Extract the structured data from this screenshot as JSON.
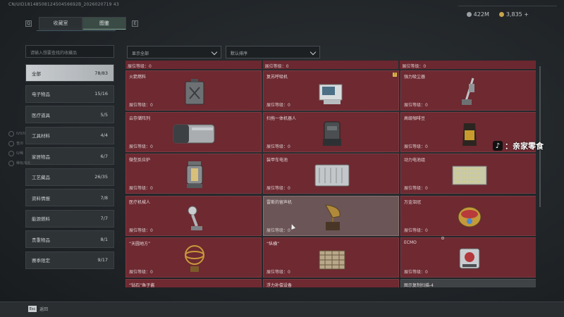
{
  "header": {
    "uid": "CN/UID1814850812450456692B_2026020719 43",
    "currencies": [
      {
        "icon": "silver-coin-icon",
        "value": "422M"
      },
      {
        "icon": "gold-coin-icon",
        "value": "3,835 +"
      }
    ]
  },
  "tabs": {
    "left_key": "Q",
    "right_key": "E",
    "items": [
      {
        "label": "收藏室",
        "active": false
      },
      {
        "label": "图鉴",
        "active": true
      }
    ]
  },
  "search": {
    "placeholder": "请输入想要查找的收藏品"
  },
  "filters": {
    "display": "显示全部",
    "sort": "默认排序"
  },
  "categories": [
    {
      "label": "全部",
      "count": "78/83",
      "active": true
    },
    {
      "label": "电子物品",
      "count": "15/16"
    },
    {
      "label": "医疗道具",
      "count": "5/5"
    },
    {
      "label": "工具材料",
      "count": "4/4"
    },
    {
      "label": "家居物品",
      "count": "6/7"
    },
    {
      "label": "工艺藏品",
      "count": "26/35"
    },
    {
      "label": "资料情报",
      "count": "7/8"
    },
    {
      "label": "能源燃料",
      "count": "7/7"
    },
    {
      "label": "贵重物品",
      "count": "8/1"
    },
    {
      "label": "赛季限定",
      "count": "9/17"
    }
  ],
  "level_label": "展位等级：0",
  "partial_top": [
    "展位等级：0",
    "展位等级：0",
    "展位等级：0"
  ],
  "cards": [
    {
      "name": "火箭燃料",
      "icon": "fuel-can-icon"
    },
    {
      "name": "复苏呼吸机",
      "icon": "ventilator-icon",
      "flag": "!"
    },
    {
      "name": "强力吸尘器",
      "icon": "vacuum-icon"
    },
    {
      "name": "云存储阵列",
      "icon": "storage-array-icon"
    },
    {
      "name": "扫拖一体机器人",
      "icon": "robot-mop-icon"
    },
    {
      "name": "高级咖啡豆",
      "icon": "coffee-bag-icon"
    },
    {
      "name": "微型反应炉",
      "icon": "reactor-icon"
    },
    {
      "name": "装甲车电池",
      "icon": "battery-icon"
    },
    {
      "name": "动力电池组",
      "icon": "battery-pack-icon"
    },
    {
      "name": "医疗机械人",
      "icon": "medical-robot-icon"
    },
    {
      "name": "雷斯的留声机",
      "icon": "gramophone-icon",
      "hover": true
    },
    {
      "name": "万金泪冠",
      "icon": "jeweled-crown-icon"
    },
    {
      "name": "“天圆地方”",
      "icon": "armillary-icon"
    },
    {
      "name": "“纵横”",
      "icon": "chessboard-icon"
    },
    {
      "name": "ECMO",
      "icon": "ecmo-icon"
    },
    {
      "name": "“钻石”鱼子酱",
      "icon": "caviar-icon"
    },
    {
      "name": "浮力补偿设备",
      "icon": "bcd-icon"
    },
    {
      "name": "图示复制扫描-4",
      "icon": "scan-icon",
      "dark": true
    }
  ],
  "side_ghost": [
    "0/0/0",
    "普/0",
    "0/稀",
    "稀有/0/0"
  ],
  "watermark": {
    "icon": "tiktok-icon",
    "text": "：亲家零食"
  },
  "footer": {
    "key": "Esc",
    "label": "返回"
  }
}
